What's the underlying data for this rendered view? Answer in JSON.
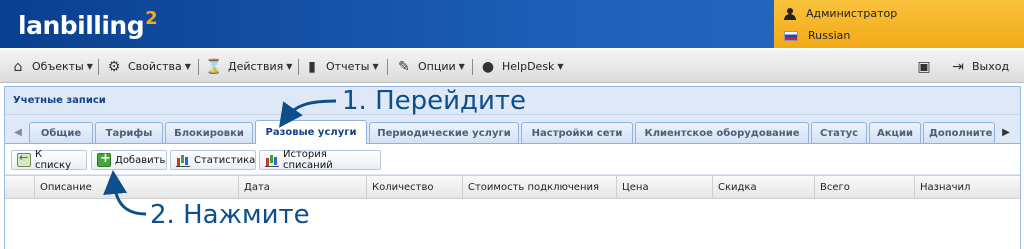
{
  "header": {
    "logo_text": "lanbilling",
    "logo_sup": "2",
    "user_name": "Администратор",
    "language": "Russian"
  },
  "menu": {
    "items": [
      {
        "label": "Объекты",
        "icon": "objects-icon"
      },
      {
        "label": "Свойства",
        "icon": "gear-icon"
      },
      {
        "label": "Действия",
        "icon": "hourglass-icon"
      },
      {
        "label": "Отчеты",
        "icon": "bar-chart-icon"
      },
      {
        "label": "Опции",
        "icon": "wrench-icon"
      },
      {
        "label": "HelpDesk",
        "icon": "chat-icon"
      }
    ],
    "exit_label": "Выход"
  },
  "panel": {
    "title": "Учетные записи",
    "tabs": [
      "Общие",
      "Тарифы",
      "Блокировки",
      "Разовые услуги",
      "Периодические услуги",
      "Настройки сети",
      "Клиентское оборудование",
      "Статус",
      "Акции",
      "Дополните"
    ],
    "active_tab": "Разовые услуги"
  },
  "toolbar": {
    "back_label": "К списку",
    "add_label": "Добавить",
    "stats_label": "Статистика",
    "history_label": "История списаний"
  },
  "grid": {
    "columns": [
      "Описание",
      "Дата",
      "Количество",
      "Стоимость подключения",
      "Цена",
      "Скидка",
      "Всего",
      "Назначил"
    ]
  },
  "annotations": {
    "step1": "1. Перейдите",
    "step2": "2. Нажмите"
  },
  "colors": {
    "header_blue": "#1d5fb8",
    "user_panel": "#f2a918",
    "annotation": "#0c4f8c",
    "panel_title": "#15428b"
  }
}
